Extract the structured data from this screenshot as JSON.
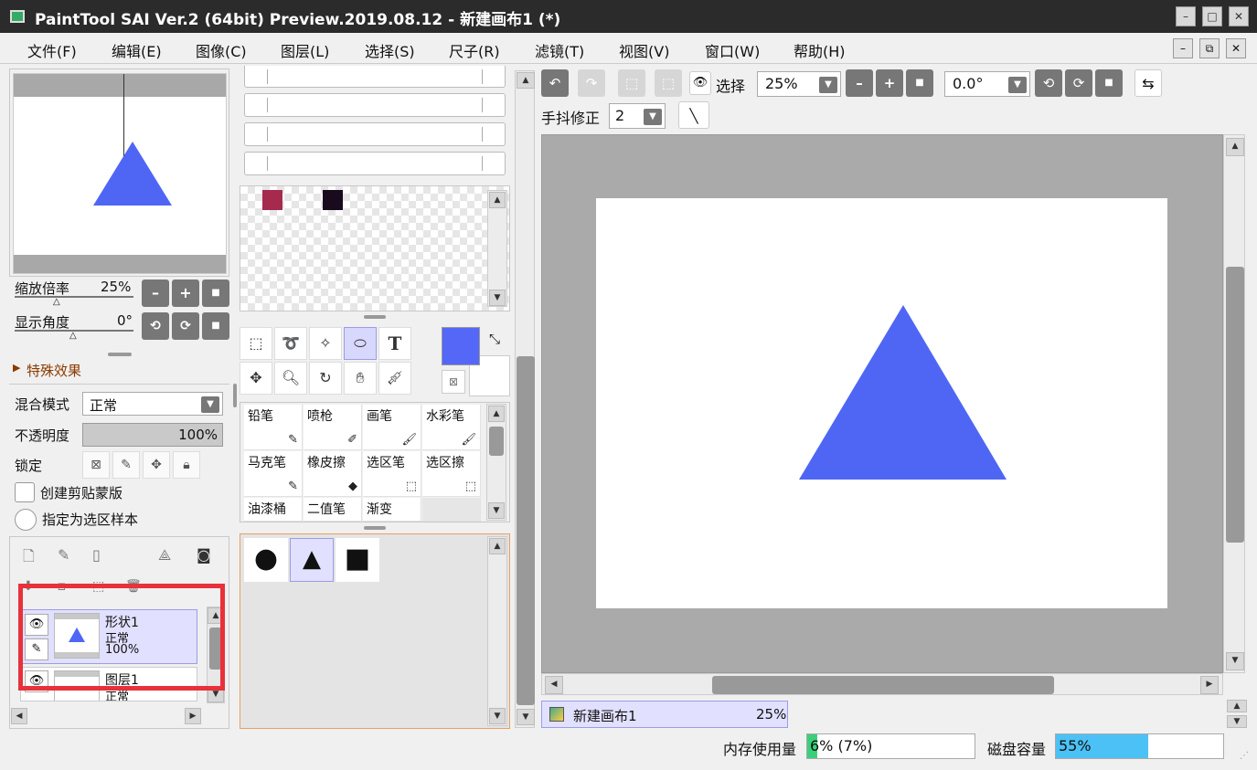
{
  "window": {
    "title": "PaintTool SAI Ver.2 (64bit) Preview.2019.08.12 - 新建画布1 (*)",
    "minimize": "–",
    "maximize": "□",
    "close": "✕"
  },
  "menu": [
    "文件(F)",
    "编辑(E)",
    "图像(C)",
    "图层(L)",
    "选择(S)",
    "尺子(R)",
    "滤镜(T)",
    "视图(V)",
    "窗口(W)",
    "帮助(H)"
  ],
  "navigator": {
    "zoom_label": "缩放倍率",
    "zoom_value": "25%",
    "angle_label": "显示角度",
    "angle_value": "0°"
  },
  "effects": {
    "label": "特殊效果"
  },
  "layer_props": {
    "blend_label": "混合模式",
    "blend_value": "正常",
    "opacity_label": "不透明度",
    "opacity_value": "100%",
    "lock_label": "锁定",
    "clip_label": "创建剪贴蒙版",
    "sample_label": "指定为选区样本"
  },
  "layers": [
    {
      "name": "形状1",
      "mode": "正常",
      "opacity": "100%"
    },
    {
      "name": "图层1",
      "mode": "正常",
      "opacity": ""
    }
  ],
  "swatches": {
    "colors": [
      "#a52a4e",
      "#1a0a1e"
    ]
  },
  "colors": {
    "primary": "#5567f7",
    "secondary": "#ffffff",
    "shape": "#4f66f5",
    "highlight": "#e8313a"
  },
  "tools": [
    "select-rect",
    "lasso",
    "magic-wand",
    "shape",
    "text",
    "move",
    "zoom",
    "rotate",
    "hand",
    "eyedropper"
  ],
  "text_tool_glyph": "T",
  "brushes": [
    "铅笔",
    "喷枪",
    "画笔",
    "水彩笔",
    "马克笔",
    "橡皮擦",
    "选区笔",
    "选区擦",
    "油漆桶",
    "二值笔",
    "渐变"
  ],
  "toolbar": {
    "select_label": "选择",
    "zoom_value": "25%",
    "angle_value": "0.0°",
    "stabilizer_label": "手抖修正",
    "stabilizer_value": "2"
  },
  "document_tab": {
    "name": "新建画布1",
    "zoom": "25%"
  },
  "status": {
    "memory_label": "内存使用量",
    "memory_value": "6% (7%)",
    "memory_fraction": 0.06,
    "disk_label": "磁盘容量",
    "disk_value": "55%",
    "disk_fraction": 0.55
  }
}
